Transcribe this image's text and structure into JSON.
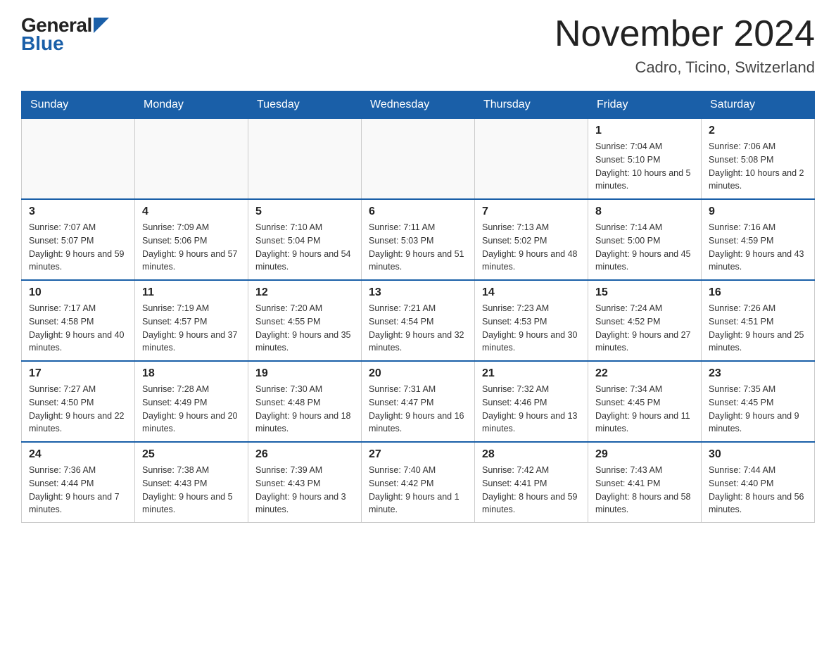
{
  "header": {
    "logo_general": "General",
    "logo_blue": "Blue",
    "month_year": "November 2024",
    "location": "Cadro, Ticino, Switzerland"
  },
  "days_of_week": [
    "Sunday",
    "Monday",
    "Tuesday",
    "Wednesday",
    "Thursday",
    "Friday",
    "Saturday"
  ],
  "weeks": [
    [
      {
        "day": "",
        "info": ""
      },
      {
        "day": "",
        "info": ""
      },
      {
        "day": "",
        "info": ""
      },
      {
        "day": "",
        "info": ""
      },
      {
        "day": "",
        "info": ""
      },
      {
        "day": "1",
        "info": "Sunrise: 7:04 AM\nSunset: 5:10 PM\nDaylight: 10 hours and 5 minutes."
      },
      {
        "day": "2",
        "info": "Sunrise: 7:06 AM\nSunset: 5:08 PM\nDaylight: 10 hours and 2 minutes."
      }
    ],
    [
      {
        "day": "3",
        "info": "Sunrise: 7:07 AM\nSunset: 5:07 PM\nDaylight: 9 hours and 59 minutes."
      },
      {
        "day": "4",
        "info": "Sunrise: 7:09 AM\nSunset: 5:06 PM\nDaylight: 9 hours and 57 minutes."
      },
      {
        "day": "5",
        "info": "Sunrise: 7:10 AM\nSunset: 5:04 PM\nDaylight: 9 hours and 54 minutes."
      },
      {
        "day": "6",
        "info": "Sunrise: 7:11 AM\nSunset: 5:03 PM\nDaylight: 9 hours and 51 minutes."
      },
      {
        "day": "7",
        "info": "Sunrise: 7:13 AM\nSunset: 5:02 PM\nDaylight: 9 hours and 48 minutes."
      },
      {
        "day": "8",
        "info": "Sunrise: 7:14 AM\nSunset: 5:00 PM\nDaylight: 9 hours and 45 minutes."
      },
      {
        "day": "9",
        "info": "Sunrise: 7:16 AM\nSunset: 4:59 PM\nDaylight: 9 hours and 43 minutes."
      }
    ],
    [
      {
        "day": "10",
        "info": "Sunrise: 7:17 AM\nSunset: 4:58 PM\nDaylight: 9 hours and 40 minutes."
      },
      {
        "day": "11",
        "info": "Sunrise: 7:19 AM\nSunset: 4:57 PM\nDaylight: 9 hours and 37 minutes."
      },
      {
        "day": "12",
        "info": "Sunrise: 7:20 AM\nSunset: 4:55 PM\nDaylight: 9 hours and 35 minutes."
      },
      {
        "day": "13",
        "info": "Sunrise: 7:21 AM\nSunset: 4:54 PM\nDaylight: 9 hours and 32 minutes."
      },
      {
        "day": "14",
        "info": "Sunrise: 7:23 AM\nSunset: 4:53 PM\nDaylight: 9 hours and 30 minutes."
      },
      {
        "day": "15",
        "info": "Sunrise: 7:24 AM\nSunset: 4:52 PM\nDaylight: 9 hours and 27 minutes."
      },
      {
        "day": "16",
        "info": "Sunrise: 7:26 AM\nSunset: 4:51 PM\nDaylight: 9 hours and 25 minutes."
      }
    ],
    [
      {
        "day": "17",
        "info": "Sunrise: 7:27 AM\nSunset: 4:50 PM\nDaylight: 9 hours and 22 minutes."
      },
      {
        "day": "18",
        "info": "Sunrise: 7:28 AM\nSunset: 4:49 PM\nDaylight: 9 hours and 20 minutes."
      },
      {
        "day": "19",
        "info": "Sunrise: 7:30 AM\nSunset: 4:48 PM\nDaylight: 9 hours and 18 minutes."
      },
      {
        "day": "20",
        "info": "Sunrise: 7:31 AM\nSunset: 4:47 PM\nDaylight: 9 hours and 16 minutes."
      },
      {
        "day": "21",
        "info": "Sunrise: 7:32 AM\nSunset: 4:46 PM\nDaylight: 9 hours and 13 minutes."
      },
      {
        "day": "22",
        "info": "Sunrise: 7:34 AM\nSunset: 4:45 PM\nDaylight: 9 hours and 11 minutes."
      },
      {
        "day": "23",
        "info": "Sunrise: 7:35 AM\nSunset: 4:45 PM\nDaylight: 9 hours and 9 minutes."
      }
    ],
    [
      {
        "day": "24",
        "info": "Sunrise: 7:36 AM\nSunset: 4:44 PM\nDaylight: 9 hours and 7 minutes."
      },
      {
        "day": "25",
        "info": "Sunrise: 7:38 AM\nSunset: 4:43 PM\nDaylight: 9 hours and 5 minutes."
      },
      {
        "day": "26",
        "info": "Sunrise: 7:39 AM\nSunset: 4:43 PM\nDaylight: 9 hours and 3 minutes."
      },
      {
        "day": "27",
        "info": "Sunrise: 7:40 AM\nSunset: 4:42 PM\nDaylight: 9 hours and 1 minute."
      },
      {
        "day": "28",
        "info": "Sunrise: 7:42 AM\nSunset: 4:41 PM\nDaylight: 8 hours and 59 minutes."
      },
      {
        "day": "29",
        "info": "Sunrise: 7:43 AM\nSunset: 4:41 PM\nDaylight: 8 hours and 58 minutes."
      },
      {
        "day": "30",
        "info": "Sunrise: 7:44 AM\nSunset: 4:40 PM\nDaylight: 8 hours and 56 minutes."
      }
    ]
  ]
}
